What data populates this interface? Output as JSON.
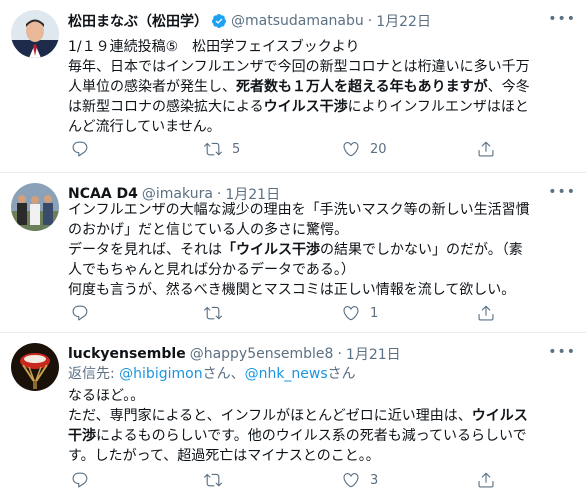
{
  "tweets": [
    {
      "name": "松田まなぶ（松田学）",
      "handle": "@matsudamanabu",
      "dot": "·",
      "date": "1月22日",
      "lines": [
        "1/１９連続投稿⑤　松田学フェイスブックより",
        "毎年、日本ではインフルエンザで今回の新型コロナとは桁違いに多い千万",
        [
          "人単位の感染者が発生し、",
          {
            "b": "死者数も１万人を超える年もありますが"
          },
          "、今冬"
        ],
        [
          "は新型コロナの感染拡大による",
          {
            "b": "ウイルス干渉"
          },
          "によりインフルエンザはほと"
        ],
        "んど流行していません。"
      ],
      "counts": {
        "reply": "",
        "retweet": "5",
        "like": "20"
      }
    },
    {
      "name": "NCAA D4",
      "handle": "@imakura",
      "dot": "·",
      "date": "1月21日",
      "lines": [
        "インフルエンザの大幅な減少の理由を「手洗いマスク等の新しい生活習慣",
        "のおかげ」だと信じている人の多さに驚愕。",
        [
          "データを見れば、それは",
          {
            "b": "「ウイルス干渉"
          },
          "の結果でしかない」のだが。（素"
        ],
        "人でもちゃんと見れば分かるデータである。）",
        "何度も言うが、然るべき機関とマスコミは正しい情報を流して欲しい。"
      ],
      "counts": {
        "reply": "",
        "retweet": "",
        "like": "1"
      }
    },
    {
      "name": "luckyensemble",
      "handle": "@happy5ensemble8",
      "dot": "·",
      "date": "1月21日",
      "reply_to": {
        "prefix": "返信先: ",
        "user1": "@hibigimon",
        "mid": "さん、",
        "user2": "@nhk_news",
        "suffix": "さん"
      },
      "lines": [
        "なるほど。。",
        [
          "ただ、専門家によると、インフルがほとんどゼロに近い理由は、",
          {
            "b": "ウイルス"
          }
        ],
        [
          {
            "b": "干渉"
          },
          "によるものらしいです。他のウイルス系の死者も減っているらしいで"
        ],
        "す。したがって、超過死亡はマイナスとのこと。。"
      ],
      "counts": {
        "reply": "",
        "retweet": "",
        "like": "3"
      }
    }
  ],
  "more_label": "•••",
  "colors": {
    "accent": "#1da1f2",
    "secondary_text": "#5b7083",
    "link": "#1b95e0"
  }
}
